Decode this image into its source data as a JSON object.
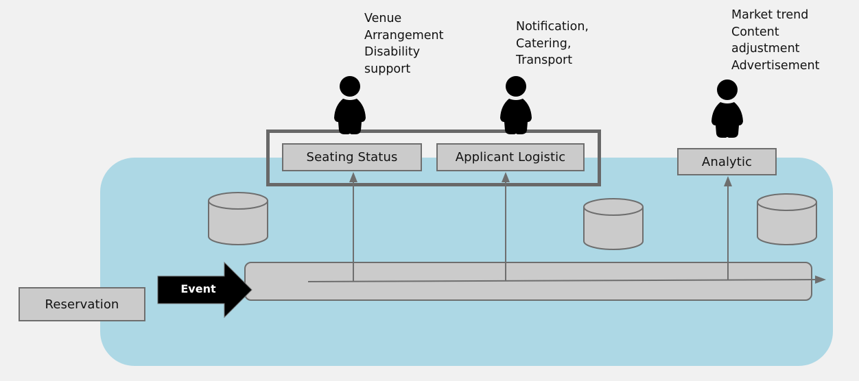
{
  "diagram": {
    "source": {
      "label": "Reservation"
    },
    "event_arrow": {
      "label": "Event"
    },
    "services": [
      {
        "id": "seating",
        "label": "Seating Status",
        "notes": [
          "Venue",
          "Arrangement",
          "Disability",
          "support"
        ]
      },
      {
        "id": "logistic",
        "label": "Applicant Logistic",
        "notes": [
          "Notification,",
          "Catering,",
          "Transport"
        ]
      },
      {
        "id": "analytic",
        "label": "Analytic",
        "notes": [
          "Market trend",
          "Content",
          "adjustment",
          "Advertisement"
        ]
      }
    ],
    "databases": [
      "database-1",
      "database-2",
      "database-3"
    ],
    "users": [
      "user-seating",
      "user-logistic",
      "user-analytic"
    ],
    "colors": {
      "background": "#f1f1f1",
      "cloud": "#add8e5",
      "box_fill": "#cbcbcb",
      "border": "#6e6e6e",
      "event_arrow": "#000000"
    }
  }
}
